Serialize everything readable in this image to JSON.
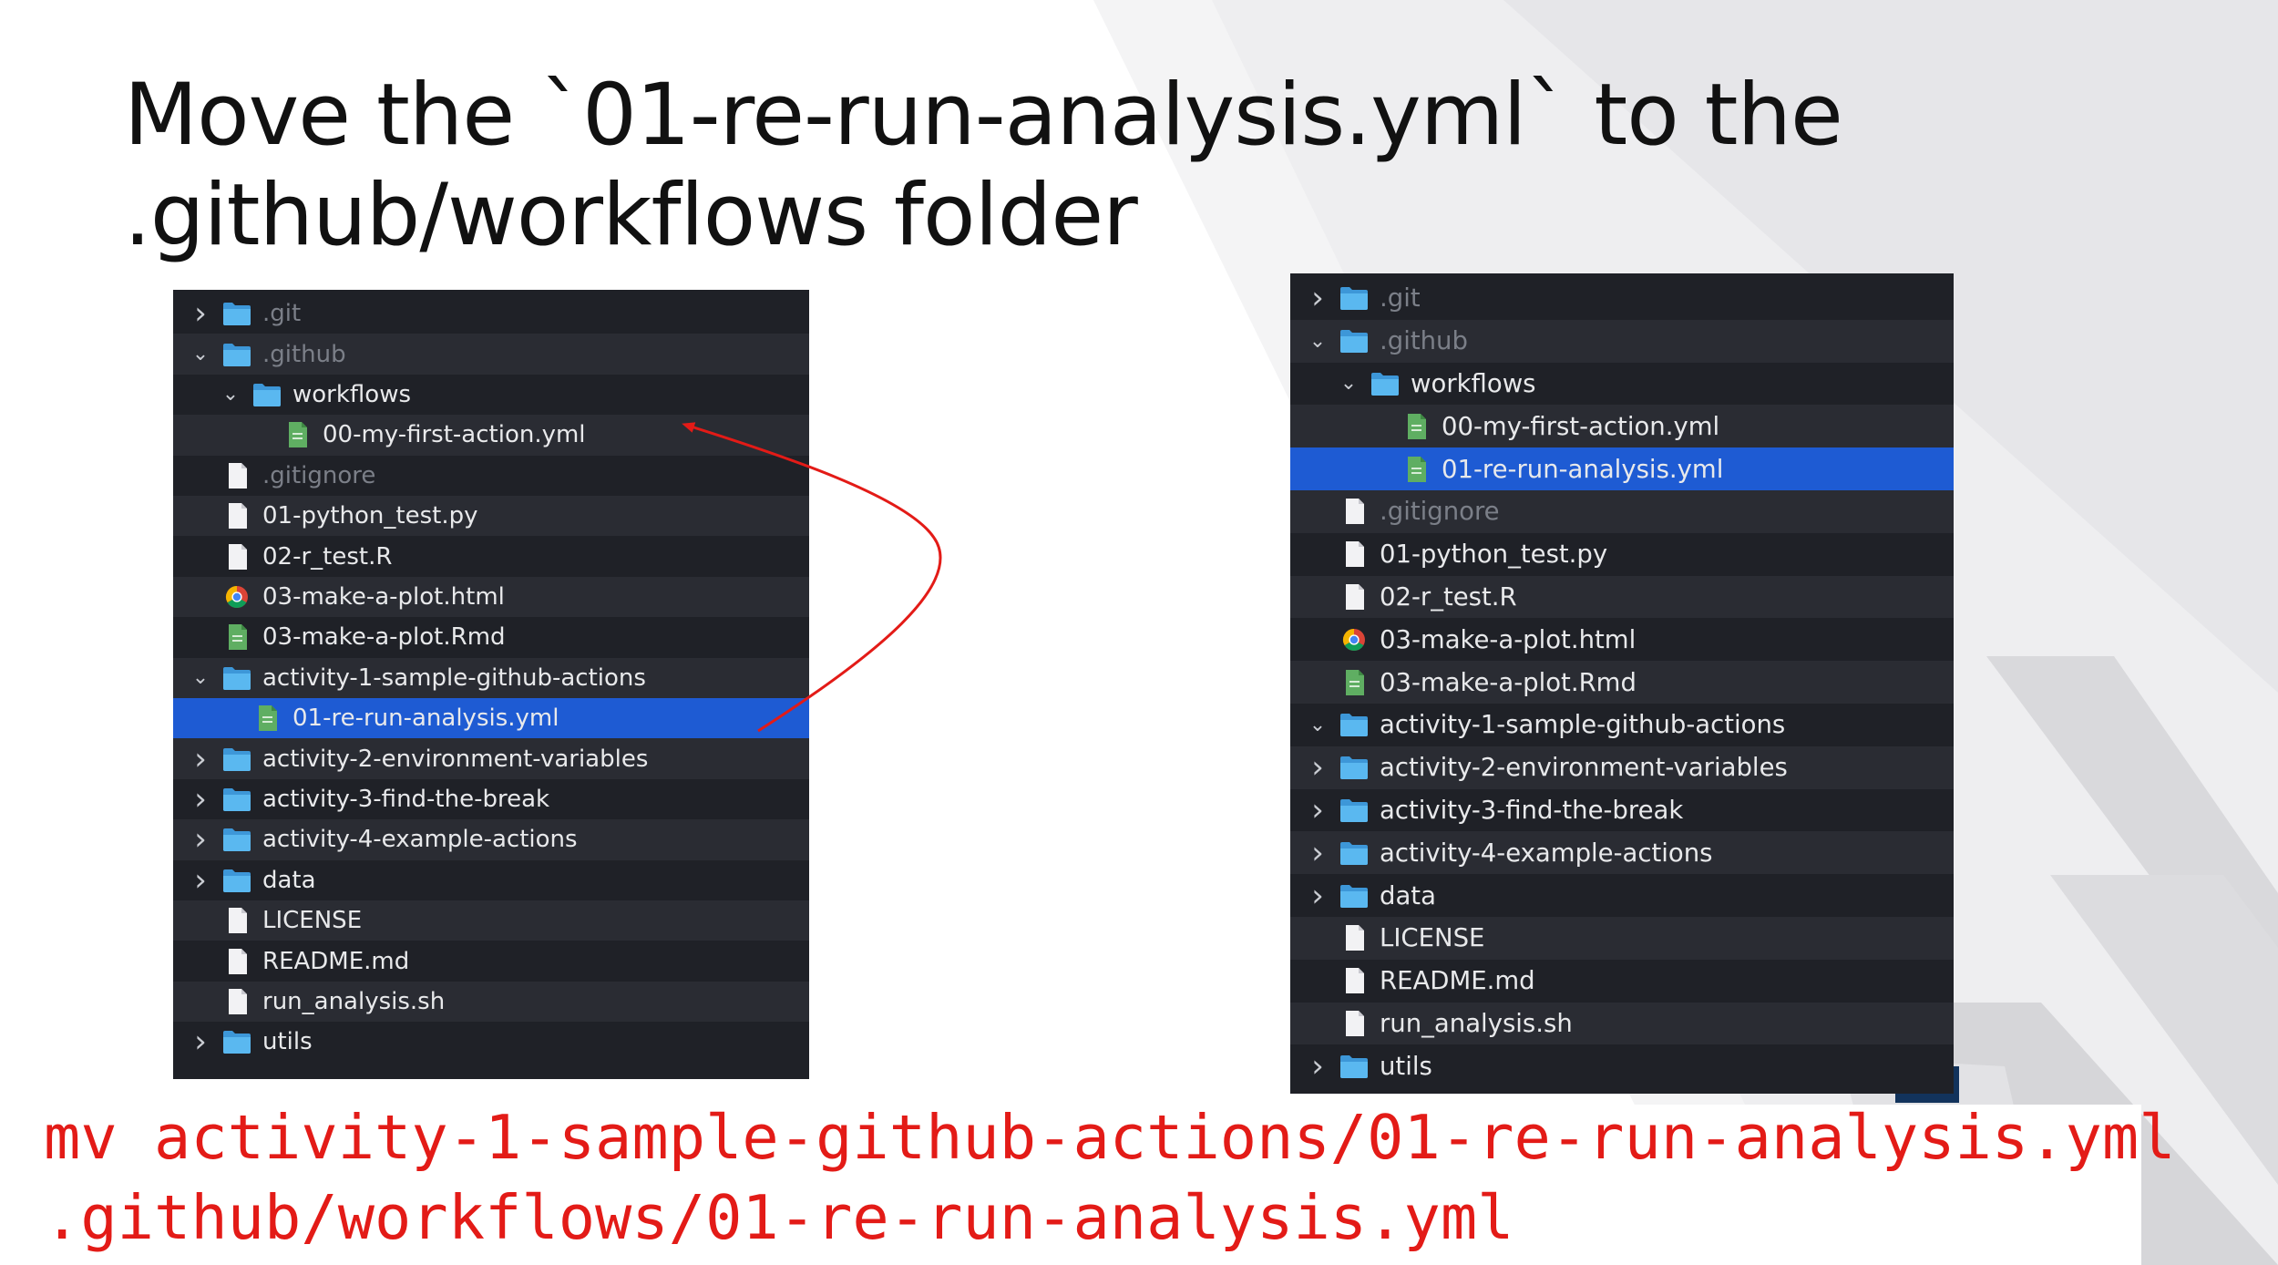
{
  "slide": {
    "title_line1": "Move the `01-re-run-analysis.yml` to the",
    "title_line2": ".github/workflows folder",
    "command_line1": "mv activity-1-sample-github-actions/01-re-run-analysis.yml",
    "command_line2": ".github/workflows/01-re-run-analysis.yml"
  },
  "colors": {
    "accent_red": "#e31b17",
    "selection_blue": "#1e5bd3",
    "panel_bg": "#1f2127",
    "folder_blue": "#52b4ee"
  },
  "left_tree": [
    {
      "label": ".git",
      "depth": 0,
      "chevron": "right",
      "icon": "folder-icon",
      "dim": true
    },
    {
      "label": ".github",
      "depth": 0,
      "chevron": "down",
      "icon": "folder-icon",
      "dim": true
    },
    {
      "label": "workflows",
      "depth": 1,
      "chevron": "down",
      "icon": "folder-icon",
      "dim": false
    },
    {
      "label": "00-my-first-action.yml",
      "depth": 2,
      "chevron": "",
      "icon": "yml-file-icon",
      "dim": false
    },
    {
      "label": ".gitignore",
      "depth": 0,
      "chevron": "",
      "icon": "file-icon",
      "dim": true
    },
    {
      "label": "01-python_test.py",
      "depth": 0,
      "chevron": "",
      "icon": "file-icon",
      "dim": false
    },
    {
      "label": "02-r_test.R",
      "depth": 0,
      "chevron": "",
      "icon": "file-icon",
      "dim": false
    },
    {
      "label": "03-make-a-plot.html",
      "depth": 0,
      "chevron": "",
      "icon": "chrome-icon",
      "dim": false
    },
    {
      "label": "03-make-a-plot.Rmd",
      "depth": 0,
      "chevron": "",
      "icon": "yml-file-icon",
      "dim": false
    },
    {
      "label": "activity-1-sample-github-actions",
      "depth": 0,
      "chevron": "down",
      "icon": "folder-icon",
      "dim": false
    },
    {
      "label": "01-re-run-analysis.yml",
      "depth": 1,
      "chevron": "",
      "icon": "yml-file-icon",
      "dim": false,
      "selected": true
    },
    {
      "label": "activity-2-environment-variables",
      "depth": 0,
      "chevron": "right",
      "icon": "folder-icon",
      "dim": false
    },
    {
      "label": "activity-3-find-the-break",
      "depth": 0,
      "chevron": "right",
      "icon": "folder-icon",
      "dim": false
    },
    {
      "label": "activity-4-example-actions",
      "depth": 0,
      "chevron": "right",
      "icon": "folder-icon",
      "dim": false
    },
    {
      "label": "data",
      "depth": 0,
      "chevron": "right",
      "icon": "folder-icon",
      "dim": false
    },
    {
      "label": "LICENSE",
      "depth": 0,
      "chevron": "",
      "icon": "file-icon",
      "dim": false
    },
    {
      "label": "README.md",
      "depth": 0,
      "chevron": "",
      "icon": "file-icon",
      "dim": false
    },
    {
      "label": "run_analysis.sh",
      "depth": 0,
      "chevron": "",
      "icon": "file-icon",
      "dim": false
    },
    {
      "label": "utils",
      "depth": 0,
      "chevron": "right",
      "icon": "folder-icon",
      "dim": false
    }
  ],
  "right_tree": [
    {
      "label": ".git",
      "depth": 0,
      "chevron": "right",
      "icon": "folder-icon",
      "dim": true
    },
    {
      "label": ".github",
      "depth": 0,
      "chevron": "down",
      "icon": "folder-icon",
      "dim": true
    },
    {
      "label": "workflows",
      "depth": 1,
      "chevron": "down",
      "icon": "folder-icon",
      "dim": false
    },
    {
      "label": "00-my-first-action.yml",
      "depth": 2,
      "chevron": "",
      "icon": "yml-file-icon",
      "dim": false
    },
    {
      "label": "01-re-run-analysis.yml",
      "depth": 2,
      "chevron": "",
      "icon": "yml-file-icon",
      "dim": false,
      "selected": true
    },
    {
      "label": ".gitignore",
      "depth": 0,
      "chevron": "",
      "icon": "file-icon",
      "dim": true
    },
    {
      "label": "01-python_test.py",
      "depth": 0,
      "chevron": "",
      "icon": "file-icon",
      "dim": false
    },
    {
      "label": "02-r_test.R",
      "depth": 0,
      "chevron": "",
      "icon": "file-icon",
      "dim": false
    },
    {
      "label": "03-make-a-plot.html",
      "depth": 0,
      "chevron": "",
      "icon": "chrome-icon",
      "dim": false
    },
    {
      "label": "03-make-a-plot.Rmd",
      "depth": 0,
      "chevron": "",
      "icon": "yml-file-icon",
      "dim": false
    },
    {
      "label": "activity-1-sample-github-actions",
      "depth": 0,
      "chevron": "down",
      "icon": "folder-icon",
      "dim": false
    },
    {
      "label": "activity-2-environment-variables",
      "depth": 0,
      "chevron": "right",
      "icon": "folder-icon",
      "dim": false
    },
    {
      "label": "activity-3-find-the-break",
      "depth": 0,
      "chevron": "right",
      "icon": "folder-icon",
      "dim": false
    },
    {
      "label": "activity-4-example-actions",
      "depth": 0,
      "chevron": "right",
      "icon": "folder-icon",
      "dim": false
    },
    {
      "label": "data",
      "depth": 0,
      "chevron": "right",
      "icon": "folder-icon",
      "dim": false
    },
    {
      "label": "LICENSE",
      "depth": 0,
      "chevron": "",
      "icon": "file-icon",
      "dim": false
    },
    {
      "label": "README.md",
      "depth": 0,
      "chevron": "",
      "icon": "file-icon",
      "dim": false
    },
    {
      "label": "run_analysis.sh",
      "depth": 0,
      "chevron": "",
      "icon": "file-icon",
      "dim": false
    },
    {
      "label": "utils",
      "depth": 0,
      "chevron": "right",
      "icon": "folder-icon",
      "dim": false
    }
  ]
}
